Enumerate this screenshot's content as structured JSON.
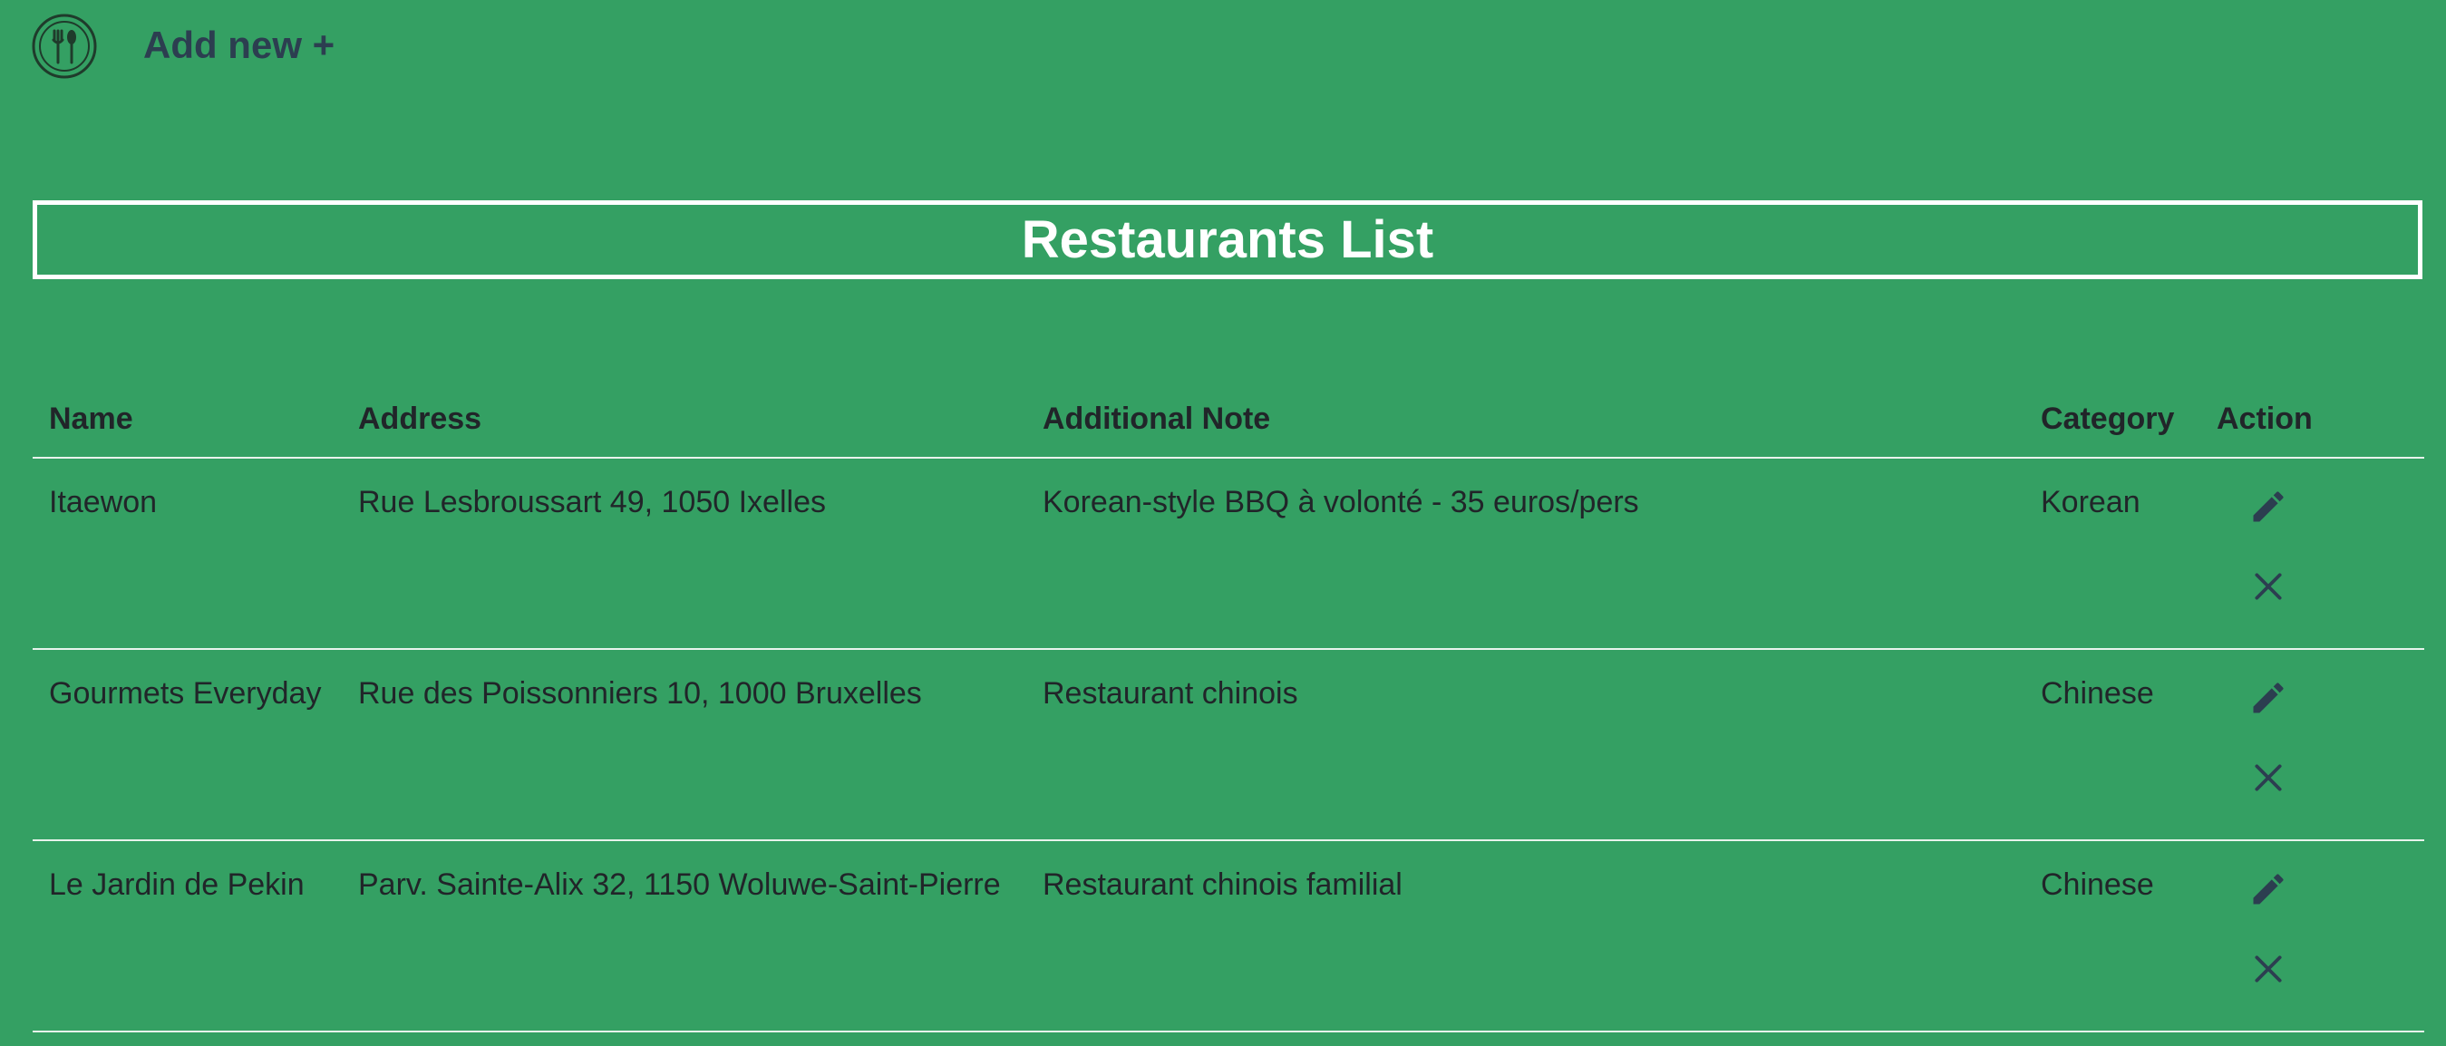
{
  "nav": {
    "logo_icon": "restaurant-utensils-icon",
    "add_new_label": "Add new +"
  },
  "page": {
    "title": "Restaurants List"
  },
  "table": {
    "headers": {
      "name": "Name",
      "address": "Address",
      "note": "Additional Note",
      "category": "Category",
      "action": "Action"
    },
    "rows": [
      {
        "name": "Itaewon",
        "address": "Rue Lesbroussart 49, 1050 Ixelles",
        "note": "Korean-style BBQ à volonté - 35 euros/pers",
        "category": "Korean"
      },
      {
        "name": "Gourmets Everyday",
        "address": "Rue des Poissonniers 10, 1000 Bruxelles",
        "note": "Restaurant chinois",
        "category": "Chinese"
      },
      {
        "name": "Le Jardin de Pekin",
        "address": "Parv. Sainte-Alix 32, 1150 Woluwe-Saint-Pierre",
        "note": "Restaurant chinois familial",
        "category": "Chinese"
      }
    ],
    "row_actions": [
      "pencil-edit-icon",
      "close-x-icon"
    ]
  },
  "colors": {
    "background": "#34a063",
    "nav_text": "#2c3e50",
    "title_text": "#ffffff",
    "body_text": "#212529",
    "row_divider": "#e8f3ec"
  }
}
